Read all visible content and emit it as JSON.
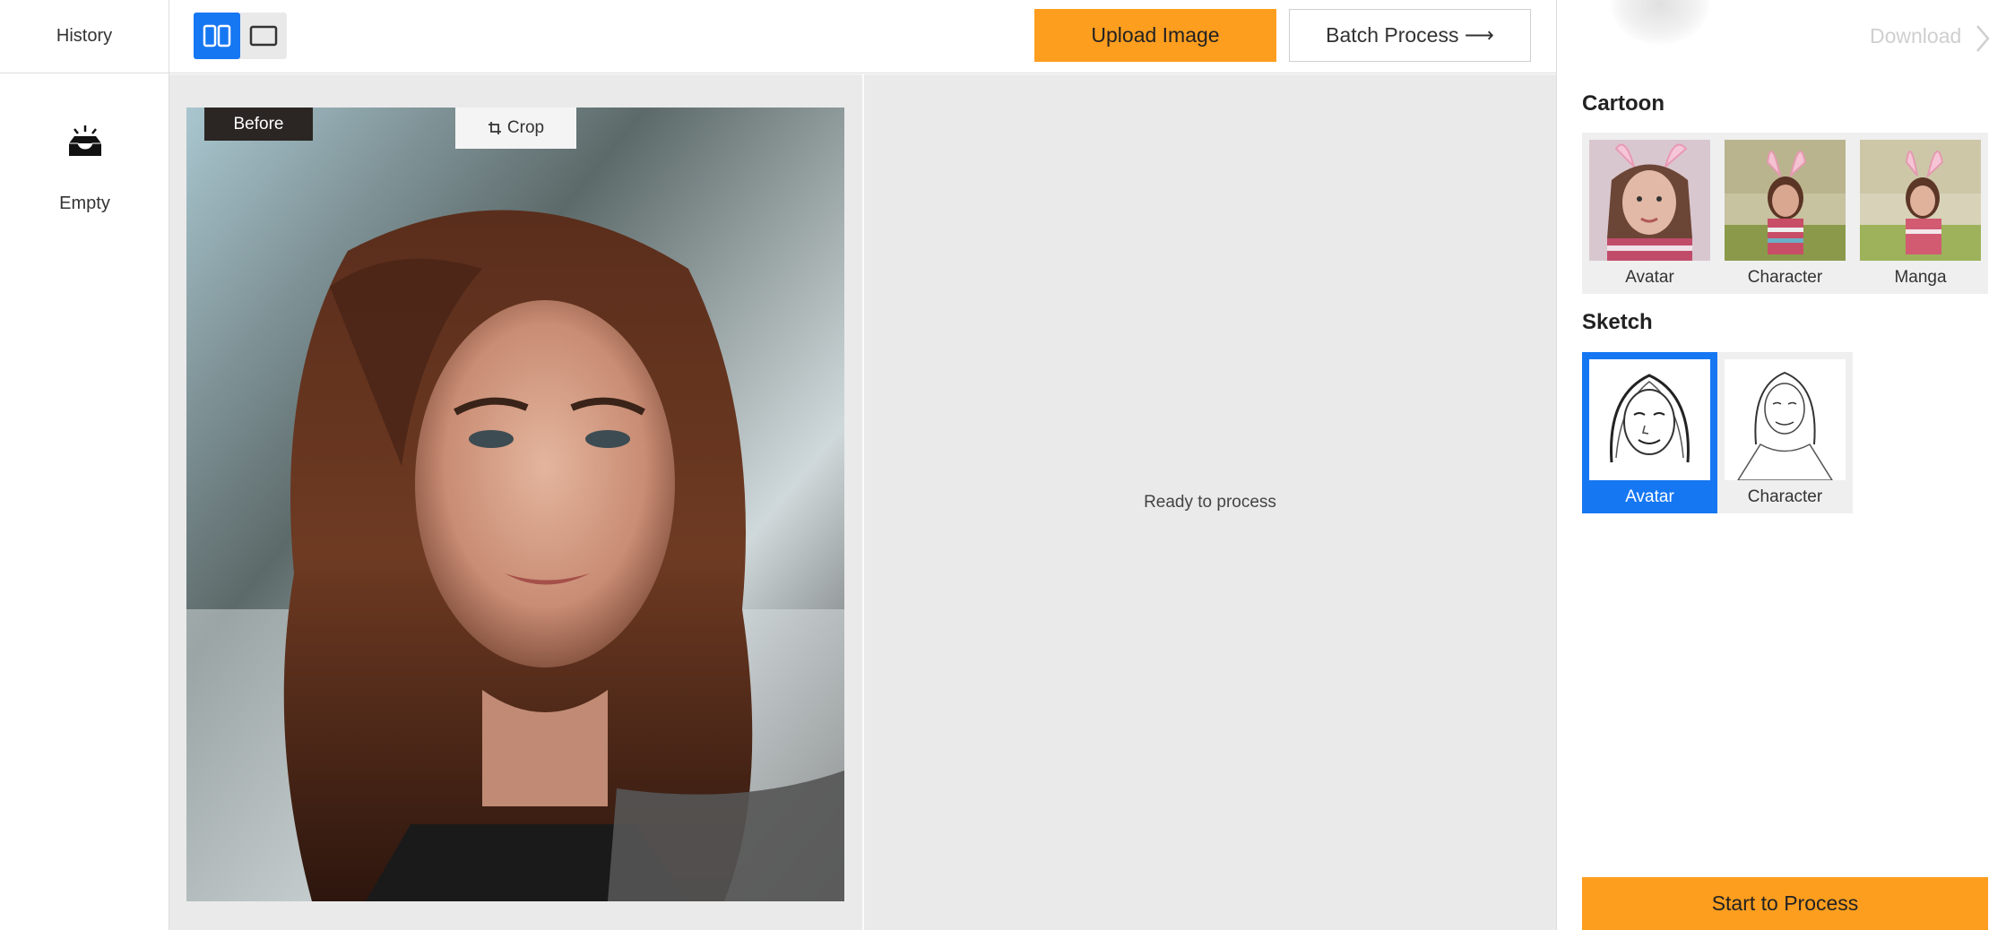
{
  "history": {
    "title": "History",
    "empty_label": "Empty"
  },
  "toolbar": {
    "view_modes": [
      "split-view",
      "single-view"
    ],
    "upload_label": "Upload Image",
    "batch_label": "Batch Process ⟶"
  },
  "workspace": {
    "before_label": "Before",
    "crop_label": "Crop",
    "result_status": "Ready to process"
  },
  "panel": {
    "download_label": "Download",
    "cartoon": {
      "title": "Cartoon",
      "styles": [
        "Avatar",
        "Character",
        "Manga"
      ]
    },
    "sketch": {
      "title": "Sketch",
      "styles": [
        "Avatar",
        "Character"
      ],
      "selected": "Avatar"
    },
    "start_label": "Start to Process"
  },
  "colors": {
    "accent_orange": "#fe9e1f",
    "accent_blue": "#1677f2",
    "workspace_bg": "#eaeaea"
  }
}
